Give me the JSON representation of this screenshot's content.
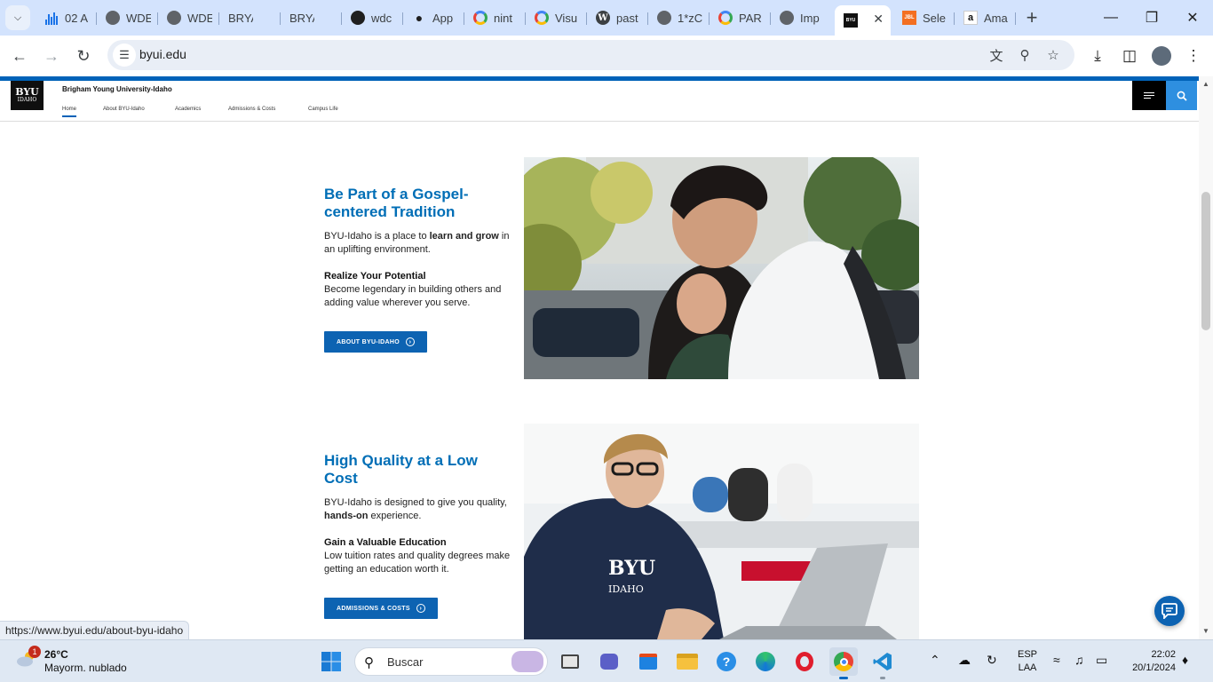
{
  "browser": {
    "tabs": [
      {
        "label": "02 A",
        "icon": "bar-chart-icon",
        "active": false
      },
      {
        "label": "WDE",
        "icon": "globe-icon",
        "active": false
      },
      {
        "label": "WDE",
        "icon": "globe-icon",
        "active": false
      },
      {
        "label": "BRYA",
        "icon": "profile-photo-icon",
        "active": false
      },
      {
        "label": "BRYA",
        "icon": "profile-photo-icon",
        "active": false
      },
      {
        "label": "wdc",
        "icon": "github-icon",
        "active": false
      },
      {
        "label": "App",
        "icon": "apple-icon",
        "active": false
      },
      {
        "label": "nint",
        "icon": "google-icon",
        "active": false
      },
      {
        "label": "Visu",
        "icon": "google-icon",
        "active": false
      },
      {
        "label": "past",
        "icon": "wordpress-icon",
        "active": false
      },
      {
        "label": "1*zC",
        "icon": "globe-icon",
        "active": false
      },
      {
        "label": "PAR",
        "icon": "google-icon",
        "active": false
      },
      {
        "label": "Imp",
        "icon": "globe-icon",
        "active": false
      },
      {
        "label": "",
        "icon": "byu-icon",
        "active": true
      },
      {
        "label": "Sele",
        "icon": "jbl-icon",
        "active": false
      },
      {
        "label": "Ama",
        "icon": "amazon-icon",
        "active": false
      }
    ],
    "url": "byui.edu",
    "status_url": "https://www.byui.edu/about-byu-idaho"
  },
  "site": {
    "logo_line1": "BYU",
    "logo_line2": "IDAHO",
    "name": "Brigham Young University-Idaho",
    "nav": [
      "Home",
      "About BYU-Idaho",
      "Academics",
      "Admissions & Costs",
      "Campus Life"
    ],
    "current_nav": "Home"
  },
  "sections": [
    {
      "heading": "Be Part of a Gospel-centered Tradition",
      "intro_pre": "BYU-Idaho is a place to ",
      "intro_bold": "learn and grow",
      "intro_post": " in an uplifting environment.",
      "subheading": "Realize Your Potential",
      "body": "Become legendary in building others and adding value wherever you serve.",
      "cta": "About BYU-Idaho"
    },
    {
      "heading": "High Quality at a Low Cost",
      "intro_pre": "BYU-Idaho is designed to give you quality, ",
      "intro_bold": "hands-on",
      "intro_post": " experience.",
      "subheading": "Gain a Valuable Education",
      "body": "Low tuition rates and quality degrees make getting an education worth it.",
      "cta": "Admissions & Costs"
    }
  ],
  "taskbar": {
    "weather_temp": "26°C",
    "weather_desc": "Mayorm. nublado",
    "weather_badge": "1",
    "search_placeholder": "Buscar",
    "lang_line1": "ESP",
    "lang_line2": "LAA",
    "time": "22:02",
    "date": "20/1/2024"
  },
  "colors": {
    "byu_blue": "#006eb6",
    "cta_blue": "#0d63b2",
    "search_blue": "#2e8fe0",
    "tabstrip": "#d3e3fd"
  }
}
